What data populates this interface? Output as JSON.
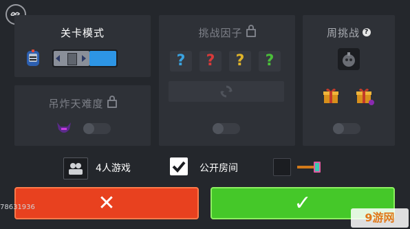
{
  "level_mode": {
    "title": "关卡模式"
  },
  "crane_difficulty": {
    "title": "吊炸天难度",
    "enabled": false
  },
  "challenge_factor": {
    "title": "挑战因子",
    "slots": [
      "?",
      "?",
      "?",
      "?"
    ],
    "slot_colors": [
      "#3aa3e0",
      "#d93a3a",
      "#e0b42a",
      "#4bbf3a"
    ],
    "enabled": false
  },
  "weekly_challenge": {
    "title": "周挑战",
    "help": "?",
    "enabled": false
  },
  "options": {
    "players_label": "4人游戏",
    "public_room_label": "公开房间",
    "public_room_checked": true,
    "weapon_checked": false
  },
  "buttons": {
    "cancel": "✕",
    "confirm": "✓"
  },
  "footer": {
    "id_text": "78631936",
    "watermark": "9游网"
  },
  "colors": {
    "cancel": "#e8411f",
    "confirm": "#45c829",
    "slider_fill": "#2d95e5"
  }
}
